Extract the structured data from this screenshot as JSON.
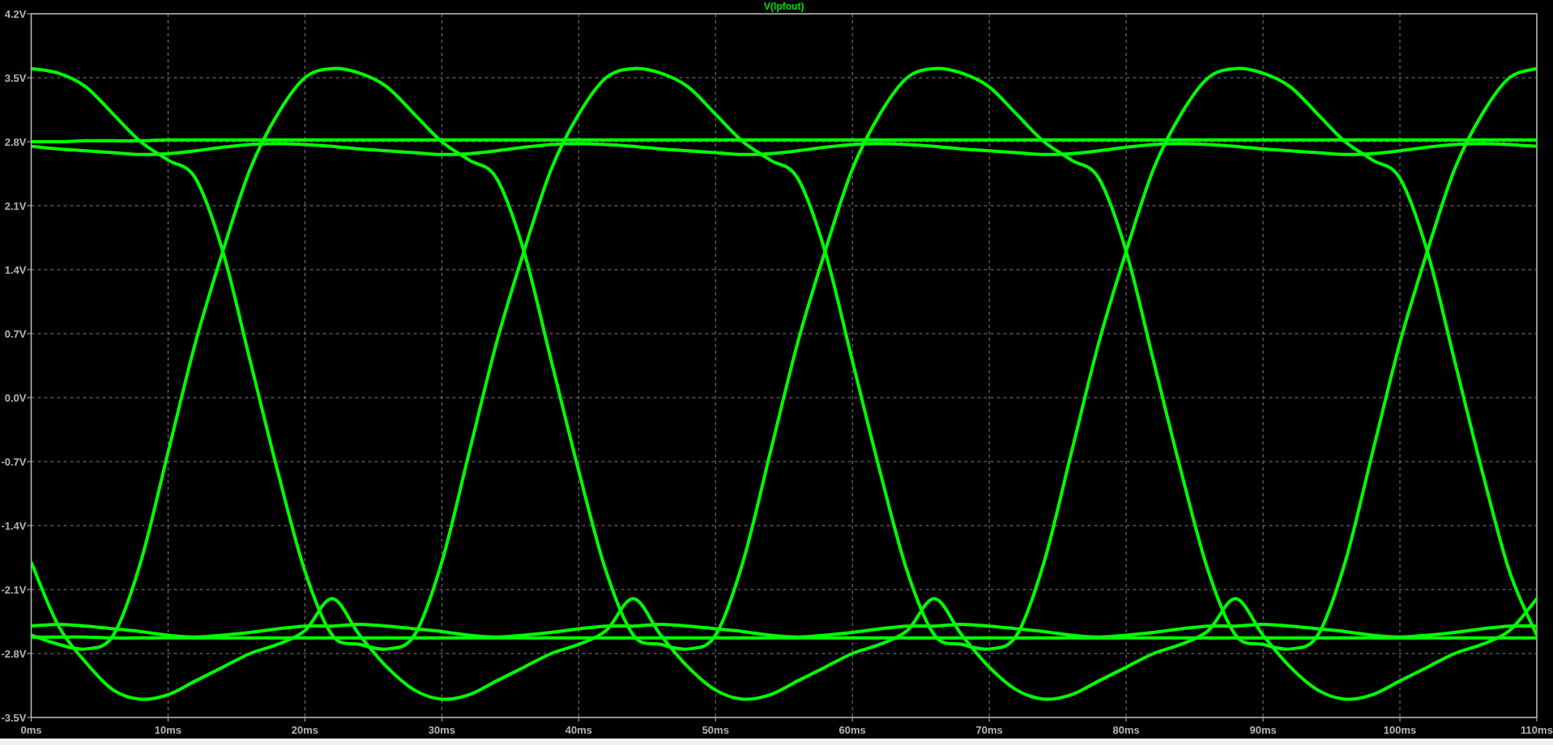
{
  "plot": {
    "chart_data": {
      "type": "line",
      "title": "V(lpfout)",
      "x": [
        0,
        2,
        4,
        6,
        8,
        10,
        12,
        14,
        16,
        18,
        20,
        22,
        24,
        26,
        28,
        30,
        32,
        34,
        36,
        38,
        40,
        42,
        44,
        46,
        48,
        50,
        52,
        54,
        56,
        58,
        60,
        62,
        64,
        66,
        68,
        70,
        72,
        74,
        76,
        78,
        80,
        82,
        84,
        86,
        88,
        90,
        92,
        94,
        96,
        98,
        100,
        102,
        104,
        106,
        108,
        110
      ],
      "grid": true,
      "xlim": [
        0,
        110
      ],
      "ylim": [
        -3.5,
        4.2
      ],
      "xticks": [
        {
          "value": 0,
          "label": "0ms"
        },
        {
          "value": 10,
          "label": "10ms"
        },
        {
          "value": 20,
          "label": "20ms"
        },
        {
          "value": 30,
          "label": "30ms"
        },
        {
          "value": 40,
          "label": "40ms"
        },
        {
          "value": 50,
          "label": "50ms"
        },
        {
          "value": 60,
          "label": "60ms"
        },
        {
          "value": 70,
          "label": "70ms"
        },
        {
          "value": 80,
          "label": "80ms"
        },
        {
          "value": 90,
          "label": "90ms"
        },
        {
          "value": 100,
          "label": "100ms"
        },
        {
          "value": 110,
          "label": "110ms"
        }
      ],
      "yticks": [
        {
          "value": 4.2,
          "label": "4.2V"
        },
        {
          "value": 3.5,
          "label": "3.5V"
        },
        {
          "value": 2.8,
          "label": "2.8V"
        },
        {
          "value": 2.1,
          "label": "2.1V"
        },
        {
          "value": 1.4,
          "label": "1.4V"
        },
        {
          "value": 0.7,
          "label": "0.7V"
        },
        {
          "value": 0,
          "label": "0.0V"
        },
        {
          "value": -0.7,
          "label": "-0.7V"
        },
        {
          "value": -1.4,
          "label": "-1.4V"
        },
        {
          "value": -2.1,
          "label": "-2.1V"
        },
        {
          "value": -2.8,
          "label": "-2.8V"
        },
        {
          "value": -3.5,
          "label": "-3.5V"
        }
      ],
      "series": [
        {
          "color": "#00ff00",
          "values": [
            -2.6,
            -2.7,
            -2.75,
            -2.6,
            -1.8,
            -0.6,
            0.6,
            1.6,
            2.5,
            3.1,
            3.5,
            3.6,
            3.55,
            3.4,
            3.1,
            2.8,
            2.6,
            2.4,
            1.6,
            0.4,
            -0.8,
            -1.9,
            -2.6,
            -2.7,
            -2.75,
            -2.6,
            -1.8,
            -0.6,
            0.6,
            1.6,
            2.5,
            3.1,
            3.5,
            3.6,
            3.55,
            3.4,
            3.1,
            2.8,
            2.6,
            2.4,
            1.6,
            0.4,
            -0.8,
            -1.9,
            -2.6,
            -2.7,
            -2.75,
            -2.6,
            -1.8,
            -0.6,
            0.6,
            1.6,
            2.5,
            3.1,
            3.5,
            3.6
          ]
        },
        {
          "color": "#00ff00",
          "values": [
            3.6,
            3.55,
            3.4,
            3.1,
            2.8,
            2.6,
            2.4,
            1.6,
            0.4,
            -0.8,
            -1.9,
            -2.6,
            -2.7,
            -2.75,
            -2.6,
            -1.8,
            -0.6,
            0.6,
            1.6,
            2.5,
            3.1,
            3.5,
            3.6,
            3.55,
            3.4,
            3.1,
            2.8,
            2.6,
            2.4,
            1.6,
            0.4,
            -0.8,
            -1.9,
            -2.6,
            -2.7,
            -2.75,
            -2.6,
            -1.8,
            -0.6,
            0.6,
            1.6,
            2.5,
            3.1,
            3.5,
            3.6,
            3.55,
            3.4,
            3.1,
            2.8,
            2.6,
            2.4,
            1.6,
            0.4,
            -0.8,
            -1.9,
            -2.6
          ]
        },
        {
          "color": "#00ff00",
          "values": [
            -1.8,
            -2.5,
            -2.9,
            -3.2,
            -3.3,
            -3.25,
            -3.1,
            -2.95,
            -2.8,
            -2.7,
            -2.55,
            -2.2,
            -2.6,
            -2.95,
            -3.2,
            -3.3,
            -3.25,
            -3.1,
            -2.95,
            -2.8,
            -2.7,
            -2.55,
            -2.2,
            -2.6,
            -2.95,
            -3.2,
            -3.3,
            -3.25,
            -3.1,
            -2.95,
            -2.8,
            -2.7,
            -2.55,
            -2.2,
            -2.6,
            -2.95,
            -3.2,
            -3.3,
            -3.25,
            -3.1,
            -2.95,
            -2.8,
            -2.7,
            -2.55,
            -2.2,
            -2.6,
            -2.95,
            -3.2,
            -3.3,
            -3.25,
            -3.1,
            -2.95,
            -2.8,
            -2.7,
            -2.55,
            -2.2
          ]
        },
        {
          "color": "#00ff00",
          "values": [
            2.75,
            2.72,
            2.7,
            2.68,
            2.66,
            2.67,
            2.7,
            2.74,
            2.77,
            2.78,
            2.77,
            2.75,
            2.72,
            2.7,
            2.68,
            2.66,
            2.67,
            2.7,
            2.74,
            2.77,
            2.78,
            2.77,
            2.75,
            2.72,
            2.7,
            2.68,
            2.66,
            2.67,
            2.7,
            2.74,
            2.77,
            2.78,
            2.77,
            2.75,
            2.72,
            2.7,
            2.68,
            2.66,
            2.67,
            2.7,
            2.74,
            2.77,
            2.78,
            2.77,
            2.75,
            2.72,
            2.7,
            2.68,
            2.66,
            2.67,
            2.7,
            2.74,
            2.77,
            2.78,
            2.77,
            2.75
          ]
        },
        {
          "color": "#00ff00",
          "values": [
            2.8,
            2.8,
            2.81,
            2.81,
            2.81,
            2.82,
            2.82,
            2.82,
            2.82,
            2.82,
            2.82,
            2.82,
            2.82,
            2.82,
            2.82,
            2.82,
            2.82,
            2.82,
            2.82,
            2.82,
            2.82,
            2.82,
            2.82,
            2.82,
            2.82,
            2.82,
            2.82,
            2.82,
            2.82,
            2.82,
            2.82,
            2.82,
            2.82,
            2.82,
            2.82,
            2.82,
            2.82,
            2.82,
            2.82,
            2.82,
            2.82,
            2.82,
            2.82,
            2.82,
            2.82,
            2.82,
            2.82,
            2.82,
            2.82,
            2.82,
            2.82,
            2.82,
            2.82,
            2.82,
            2.82,
            2.82
          ]
        },
        {
          "color": "#00ff00",
          "values": [
            -2.5,
            -2.48,
            -2.5,
            -2.53,
            -2.56,
            -2.6,
            -2.62,
            -2.6,
            -2.57,
            -2.53,
            -2.5,
            -2.5,
            -2.48,
            -2.5,
            -2.53,
            -2.56,
            -2.6,
            -2.62,
            -2.6,
            -2.57,
            -2.53,
            -2.5,
            -2.5,
            -2.48,
            -2.5,
            -2.53,
            -2.56,
            -2.6,
            -2.62,
            -2.6,
            -2.57,
            -2.53,
            -2.5,
            -2.5,
            -2.48,
            -2.5,
            -2.53,
            -2.56,
            -2.6,
            -2.62,
            -2.6,
            -2.57,
            -2.53,
            -2.5,
            -2.5,
            -2.48,
            -2.5,
            -2.53,
            -2.56,
            -2.6,
            -2.62,
            -2.6,
            -2.57,
            -2.53,
            -2.5,
            -2.5
          ]
        },
        {
          "color": "#00ff00",
          "values": [
            -2.62,
            -2.62,
            -2.62,
            -2.63,
            -2.63,
            -2.63,
            -2.63,
            -2.63,
            -2.63,
            -2.63,
            -2.63,
            -2.63,
            -2.63,
            -2.63,
            -2.63,
            -2.63,
            -2.63,
            -2.63,
            -2.63,
            -2.63,
            -2.63,
            -2.63,
            -2.63,
            -2.63,
            -2.63,
            -2.63,
            -2.63,
            -2.63,
            -2.63,
            -2.63,
            -2.63,
            -2.63,
            -2.63,
            -2.63,
            -2.63,
            -2.63,
            -2.63,
            -2.63,
            -2.63,
            -2.63,
            -2.63,
            -2.63,
            -2.63,
            -2.63,
            -2.63,
            -2.63,
            -2.63,
            -2.63,
            -2.63,
            -2.63,
            -2.63,
            -2.63,
            -2.63,
            -2.63,
            -2.63,
            -2.63
          ]
        }
      ]
    }
  }
}
